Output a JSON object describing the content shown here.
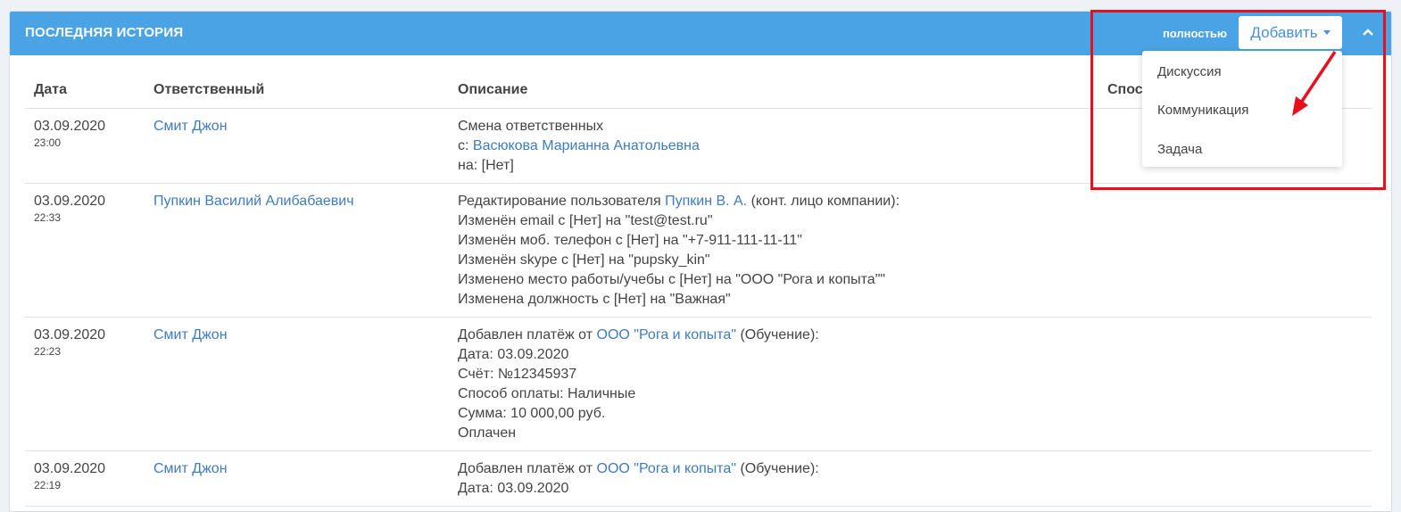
{
  "panel": {
    "title": "ПОСЛЕДНЯЯ ИСТОРИЯ",
    "full_link": "полностью",
    "add_button": "Добавить"
  },
  "table": {
    "headers": [
      "Дата",
      "Ответственный",
      "Описание",
      "Спос"
    ],
    "rows": [
      {
        "date": "03.09.2020",
        "time": "23:00",
        "responsible": "Смит Джон",
        "lines": [
          {
            "text": "Смена ответственных"
          },
          {
            "prefix": "с: ",
            "link": "Васюкова Марианна Анатольевна"
          },
          {
            "text": "на: [Нет]"
          }
        ]
      },
      {
        "date": "03.09.2020",
        "time": "22:33",
        "responsible": "Пупкин Василий Алибабаевич",
        "lines": [
          {
            "prefix": "Редактирование пользователя ",
            "link": "Пупкин В. А.",
            "suffix": " (конт. лицо компании):"
          },
          {
            "text": "Изменён email с [Нет] на \"test@test.ru\""
          },
          {
            "text": "Изменён моб. телефон с [Нет] на \"+7-911-111-11-11\""
          },
          {
            "text": "Изменён skype с [Нет] на \"pupsky_kin\""
          },
          {
            "text": "Изменено место работы/учебы с [Нет] на \"ООО \"Рога и копыта\"\""
          },
          {
            "text": "Изменена должность с [Нет] на \"Важная\""
          }
        ]
      },
      {
        "date": "03.09.2020",
        "time": "22:23",
        "responsible": "Смит Джон",
        "lines": [
          {
            "prefix": "Добавлен платёж от ",
            "link": "ООО \"Рога и копыта\"",
            "suffix": " (Обучение):"
          },
          {
            "text": "Дата: 03.09.2020"
          },
          {
            "text": "Счёт: №12345937"
          },
          {
            "text": "Способ оплаты: Наличные"
          },
          {
            "text": "Сумма: 10 000,00 руб."
          },
          {
            "text": "Оплачен"
          }
        ]
      },
      {
        "date": "03.09.2020",
        "time": "22:19",
        "responsible": "Смит Джон",
        "lines": [
          {
            "prefix": "Добавлен платёж от ",
            "link": "ООО \"Рога и копыта\"",
            "suffix": " (Обучение):"
          },
          {
            "text": "Дата: 03.09.2020"
          }
        ]
      }
    ]
  },
  "dropdown": {
    "items": [
      "Дискуссия",
      "Коммуникация",
      "Задача"
    ]
  },
  "colors": {
    "header_bg": "#4aa3e4",
    "link": "#3f7bbf",
    "highlight": "#e8101e"
  }
}
